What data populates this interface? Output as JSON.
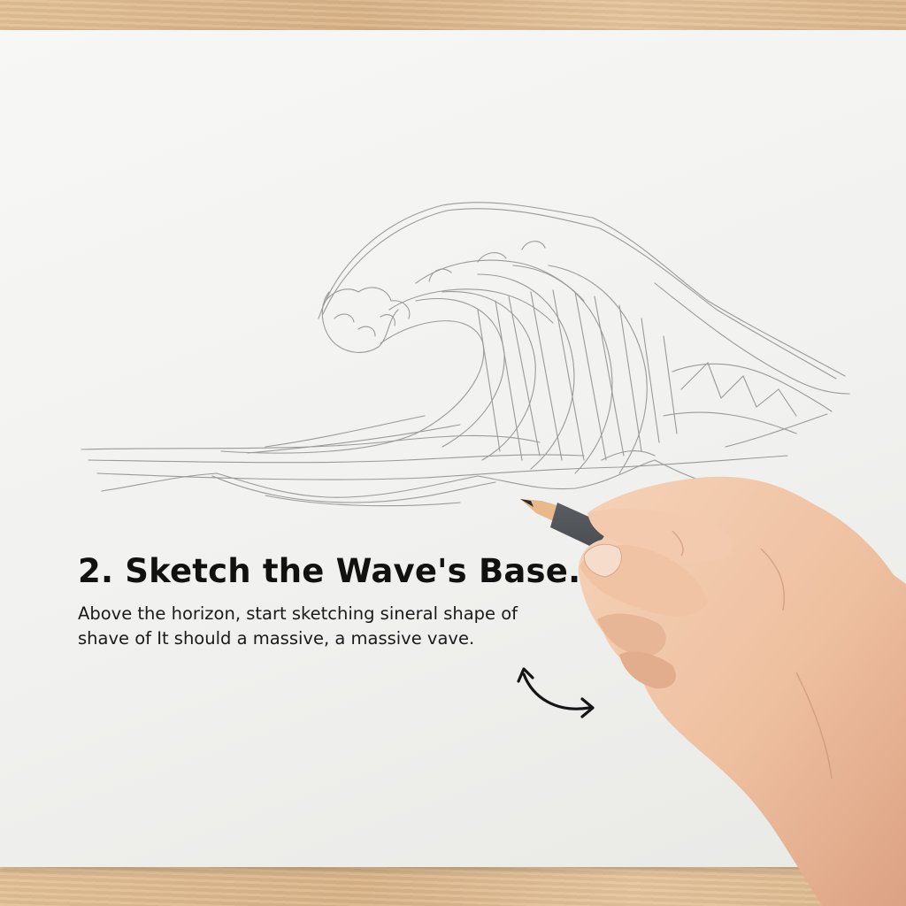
{
  "instruction": {
    "title": "2. Sketch the Wave's Base.",
    "body": "Above the horizon, start sketching sineral shape of shave of It should a massive, a massive vave."
  },
  "icons": {
    "arrow": "curved-double-arrow-icon"
  },
  "colors": {
    "paper": "#f3f3f1",
    "table": "#dcb68a",
    "text": "#111111",
    "pencil": "#3a3d40",
    "skin": "#f0c4a6"
  }
}
